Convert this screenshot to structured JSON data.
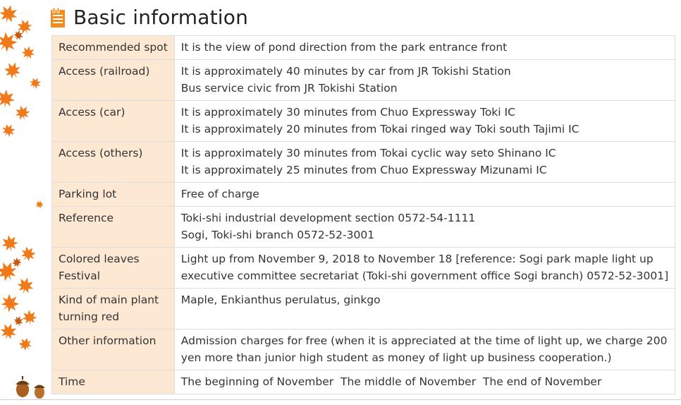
{
  "heading": {
    "title": "Basic information",
    "icon": "document-icon",
    "accent_color": "#f18d1f"
  },
  "decor": {
    "leaf_color": "#f07a1a",
    "label_background": "#fde8d4"
  },
  "rows": [
    {
      "label_lines": [
        "Recommended spot"
      ],
      "value_lines": [
        "It is the view of pond direction from the park entrance front"
      ]
    },
    {
      "label_lines": [
        "Access (railroad)"
      ],
      "value_lines": [
        "It is approximately 40 minutes by car from JR Tokishi Station",
        "Bus service civic from JR Tokishi Station"
      ]
    },
    {
      "label_lines": [
        "Access (car)"
      ],
      "value_lines": [
        "It is approximately 30 minutes from Chuo Expressway Toki IC",
        "It is approximately 20 minutes from Tokai ringed way Toki south Tajimi IC"
      ]
    },
    {
      "label_lines": [
        "Access (others)"
      ],
      "value_lines": [
        "It is approximately 30 minutes from Tokai cyclic way seto Shinano IC",
        "It is approximately 25 minutes from Chuo Expressway Mizunami IC"
      ]
    },
    {
      "label_lines": [
        "Parking lot"
      ],
      "value_lines": [
        "Free of charge"
      ]
    },
    {
      "label_lines": [
        "Reference"
      ],
      "value_lines": [
        "Toki-shi industrial development section 0572-54-1111",
        "Sogi, Toki-shi branch 0572-52-3001"
      ]
    },
    {
      "label_lines": [
        "Colored leaves",
        "Festival"
      ],
      "value_lines": [
        "Light up from November 9, 2018 to November 18 [reference: Sogi park maple light up",
        "executive committee secretariat (Toki-shi government office Sogi branch) 0572-52-3001]"
      ]
    },
    {
      "label_lines": [
        "Kind of main plant",
        "turning red"
      ],
      "value_lines": [
        "Maple, Enkianthus perulatus, ginkgo"
      ]
    },
    {
      "label_lines": [
        "Other information"
      ],
      "value_lines": [
        "Admission charges for free (when it is appreciated at the time of light up, we charge 200",
        "yen more than junior high student as money of light up business cooperation.)"
      ]
    },
    {
      "label_lines": [
        "Time"
      ],
      "value_lines": [
        "The beginning of November  The middle of November  The end of November"
      ]
    }
  ]
}
